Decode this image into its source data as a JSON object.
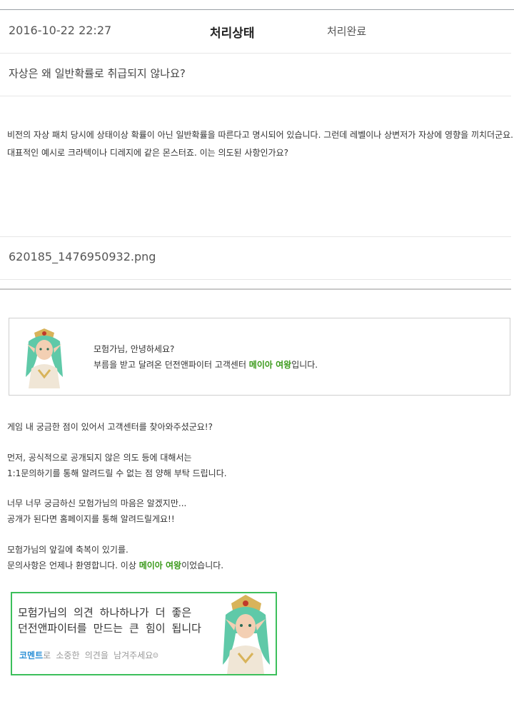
{
  "inquiry": {
    "date": "2016-10-22 22:27",
    "status_label": "처리상태",
    "status_value": "처리완료",
    "title": "자상은 왜 일반확률로 취급되지 않나요?",
    "body": "비전의 자상 패치 당시에 상태이상 확률이 아닌 일반확률을 따른다고 명시되어 있습니다. 그런데 레벨이나 상변저가 자상에 영향을 끼치더군요. 대표적인 예시로 크라텍이나 디레지에 같은 몬스터죠. 이는 의도된 사항인가요?",
    "attachment": "620185_1476950932.png"
  },
  "reply": {
    "greeting_line1": "모험가님, 안녕하세요?",
    "greeting_line2_pre": "부름을 받고 달려온 던전앤파이터 고객센터 ",
    "greeting_name": "메이아 여왕",
    "greeting_line2_post": "입니다.",
    "p1": "게임 내 궁금한 점이 있어서 고객센터를 찾아와주셨군요!?",
    "p2_line1": "먼저, 공식적으로 공개되지 않은 의도 등에 대해서는",
    "p2_line2": "1:1문의하기를 통해 알려드릴 수 없는 점 양해 부탁 드립니다.",
    "p3_line1": "너무 너무 궁금하신 모험가님의 마음은 알겠지만...",
    "p3_line2": "공개가 된다면 홈페이지를 통해 알려드릴게요!!",
    "p4_line1": "모험가님의 앞길에 축복이 있기를.",
    "p4_line2_pre": "문의사항은 언제나 환영합니다. 이상 ",
    "p4_name": "메이아 여왕",
    "p4_line2_post": "이었습니다."
  },
  "banner": {
    "line1": "모험가님의 의견 하나하나가 더 좋은",
    "line2": "던전앤파이터를 만드는 큰 힘이 됩니다",
    "line3_highlight": "코멘트",
    "line3_rest": "로 소중한 의견을 남겨주세요☺"
  },
  "colors": {
    "name_green": "#3a9a1a",
    "banner_border": "#3cbf5b",
    "comment_blue": "#2a8fd6"
  }
}
